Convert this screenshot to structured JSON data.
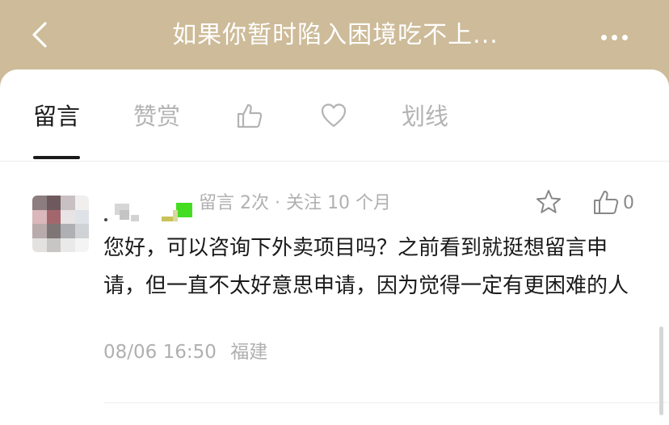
{
  "header": {
    "title": "如果你暂时陷入困境吃不上...",
    "back_icon": "chevron-left-icon",
    "more_icon": "more-dots-icon",
    "background": "#cdbb99"
  },
  "tabs": [
    {
      "label": "留言",
      "active": true
    },
    {
      "label": "赞赏",
      "active": false
    },
    {
      "icon": "thumbs-up-icon"
    },
    {
      "icon": "heart-icon"
    },
    {
      "label": "划线",
      "active": false
    }
  ],
  "comment": {
    "name": ".",
    "meta": "留言 2次 · 关注 10 个月",
    "likes": "0",
    "text": "您好，可以咨询下外卖项目吗？之前看到就挺想留言申请，但一直不太好意思申请，因为觉得一定有更困难的人",
    "time": "08/06 16:50",
    "location": "福建",
    "star_icon": "star-icon",
    "like_icon": "thumbs-up-icon"
  }
}
